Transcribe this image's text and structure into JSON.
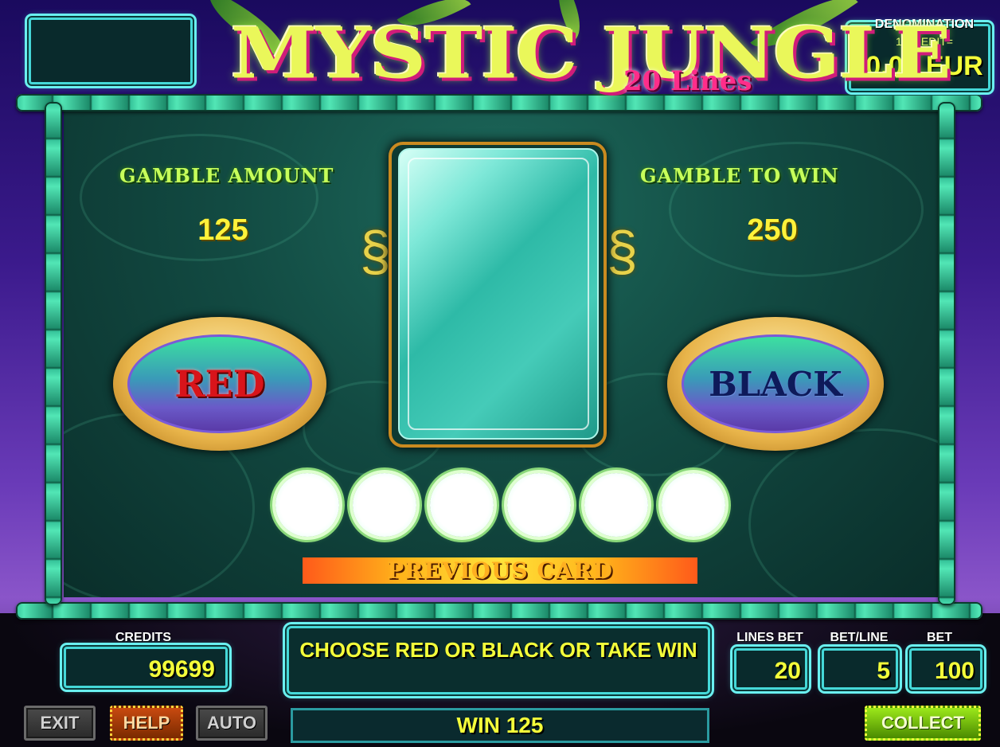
{
  "game": {
    "title": "MYSTIC JUNGLE",
    "subtitle": "20 Lines"
  },
  "denomination": {
    "caption": "DENOMINATION",
    "per_credit": "1 CREDIT=",
    "value": "0.01 EUR"
  },
  "gamble": {
    "amount_label": "GAMBLE AMOUNT",
    "amount_value": "125",
    "to_win_label": "GAMBLE TO WIN",
    "to_win_value": "250",
    "red_label": "RED",
    "black_label": "BLACK",
    "previous_card_label": "PREVIOUS CARD",
    "previous_cards_shown": 6
  },
  "status": {
    "credits_label": "CREDITS",
    "credits_value": "99699",
    "message": "CHOOSE RED OR BLACK OR TAKE WIN",
    "win_text": "WIN 125",
    "lines_bet_label": "LINES BET",
    "lines_bet_value": "20",
    "bet_per_line_label": "BET/LINE",
    "bet_per_line_value": "5",
    "bet_label": "BET",
    "bet_value": "100"
  },
  "buttons": {
    "exit": "EXIT",
    "help": "HELP",
    "auto": "AUTO",
    "collect": "COLLECT"
  },
  "colors": {
    "red_text": "#d8141a",
    "black_text": "#0e1a5a",
    "value_yellow": "#f4ff3a",
    "frame_cyan": "#45d8d8",
    "bamboo_green": "#36c49a"
  }
}
